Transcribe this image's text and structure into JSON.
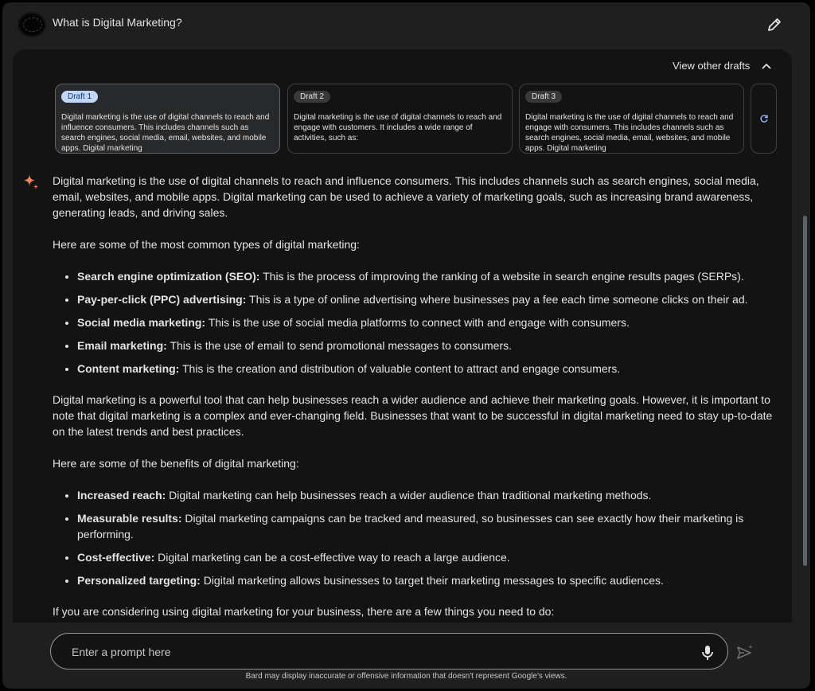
{
  "header": {
    "title": "What is Digital Marketing?"
  },
  "drafts": {
    "toggle_label": "View other drafts",
    "items": [
      {
        "label": "Draft 1",
        "text": "Digital marketing is the use of digital channels to reach and influence consumers. This includes channels such as search engines, social media, email, websites, and mobile apps. Digital marketing"
      },
      {
        "label": "Draft 2",
        "text": "Digital marketing is the use of digital channels to reach and engage with customers. It includes a wide range of activities, such as:"
      },
      {
        "label": "Draft 3",
        "text": "Digital marketing is the use of digital channels to reach and engage with consumers. This includes channels such as search engines, social media, email, websites, and mobile apps. Digital marketing"
      }
    ]
  },
  "response": {
    "p1": "Digital marketing is the use of digital channels to reach and influence consumers. This includes channels such as search engines, social media, email, websites, and mobile apps. Digital marketing can be used to achieve a variety of marketing goals, such as increasing brand awareness, generating leads, and driving sales.",
    "p2": "Here are some of the most common types of digital marketing:",
    "types": [
      {
        "term": "Search engine optimization (SEO):",
        "desc": " This is the process of improving the ranking of a website in search engine results pages (SERPs)."
      },
      {
        "term": "Pay-per-click (PPC) advertising:",
        "desc": " This is a type of online advertising where businesses pay a fee each time someone clicks on their ad."
      },
      {
        "term": "Social media marketing:",
        "desc": " This is the use of social media platforms to connect with and engage with consumers."
      },
      {
        "term": "Email marketing:",
        "desc": " This is the use of email to send promotional messages to consumers."
      },
      {
        "term": "Content marketing:",
        "desc": " This is the creation and distribution of valuable content to attract and engage consumers."
      }
    ],
    "p3": "Digital marketing is a powerful tool that can help businesses reach a wider audience and achieve their marketing goals. However, it is important to note that digital marketing is a complex and ever-changing field. Businesses that want to be successful in digital marketing need to stay up-to-date on the latest trends and best practices.",
    "p4": "Here are some of the benefits of digital marketing:",
    "benefits": [
      {
        "term": "Increased reach:",
        "desc": " Digital marketing can help businesses reach a wider audience than traditional marketing methods."
      },
      {
        "term": "Measurable results:",
        "desc": " Digital marketing campaigns can be tracked and measured, so businesses can see exactly how their marketing is performing."
      },
      {
        "term": "Cost-effective:",
        "desc": " Digital marketing can be a cost-effective way to reach a large audience."
      },
      {
        "term": "Personalized targeting:",
        "desc": " Digital marketing allows businesses to target their marketing messages to specific audiences."
      }
    ],
    "p5": "If you are considering using digital marketing for your business, there are a few things you need to do:"
  },
  "input": {
    "placeholder": "Enter a prompt here"
  },
  "footer": {
    "disclaimer": "Bard may display inaccurate or offensive information that doesn't represent Google's views."
  },
  "colors": {
    "background": "#131314",
    "accent_badge": "#c2d7f7",
    "text": "#e3e3e3"
  },
  "icons": {
    "edit": "pencil-icon",
    "toggle": "chevron-up-icon",
    "regenerate": "refresh-icon",
    "assistant": "sparkle-icon",
    "mic": "mic-icon",
    "send": "send-icon"
  }
}
